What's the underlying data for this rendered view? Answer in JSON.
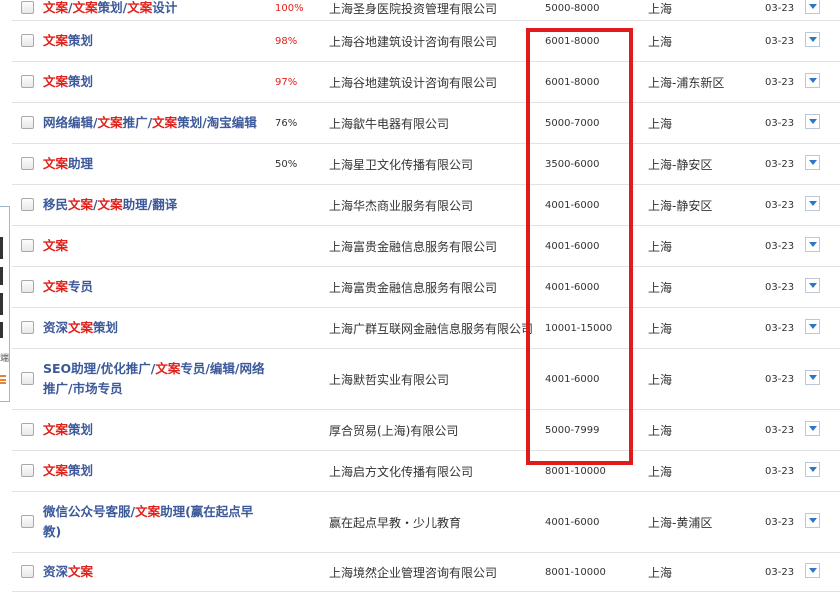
{
  "side_widget": {
    "text": "端"
  },
  "jobs": [
    {
      "title": [
        {
          "t": "文案",
          "hl": true
        },
        {
          "t": "/"
        },
        {
          "t": "文案",
          "hl": true
        },
        {
          "t": "策划/"
        },
        {
          "t": "文案",
          "hl": true
        },
        {
          "t": "设计"
        }
      ],
      "match": "100%",
      "match_red": true,
      "company": "上海圣身医院投资管理有限公司",
      "salary": "5000-8000",
      "location": "上海",
      "date": "03-23"
    },
    {
      "title": [
        {
          "t": "文案",
          "hl": true
        },
        {
          "t": "策划"
        }
      ],
      "match": "98%",
      "match_red": true,
      "company": "上海谷地建筑设计咨询有限公司",
      "salary": "6001-8000",
      "location": "上海",
      "date": "03-23"
    },
    {
      "title": [
        {
          "t": "文案",
          "hl": true
        },
        {
          "t": "策划"
        }
      ],
      "match": "97%",
      "match_red": true,
      "company": "上海谷地建筑设计咨询有限公司",
      "salary": "6001-8000",
      "location": "上海-浦东新区",
      "date": "03-23"
    },
    {
      "title": [
        {
          "t": "网络编辑/"
        },
        {
          "t": "文案",
          "hl": true
        },
        {
          "t": "推广/"
        },
        {
          "t": "文案",
          "hl": true
        },
        {
          "t": "策划/淘宝编辑"
        }
      ],
      "match": "76%",
      "match_red": false,
      "company": "上海歙牛电器有限公司",
      "salary": "5000-7000",
      "location": "上海",
      "date": "03-23"
    },
    {
      "title": [
        {
          "t": "文案",
          "hl": true
        },
        {
          "t": "助理"
        }
      ],
      "match": "50%",
      "match_red": false,
      "company": "上海星卫文化传播有限公司",
      "salary": "3500-6000",
      "location": "上海-静安区",
      "date": "03-23"
    },
    {
      "title": [
        {
          "t": "移民"
        },
        {
          "t": "文案",
          "hl": true
        },
        {
          "t": "/"
        },
        {
          "t": "文案",
          "hl": true
        },
        {
          "t": "助理/翻译"
        }
      ],
      "match": "",
      "match_red": false,
      "company": "上海华杰商业服务有限公司",
      "salary": "4001-6000",
      "location": "上海-静安区",
      "date": "03-23"
    },
    {
      "title": [
        {
          "t": "文案",
          "hl": true
        }
      ],
      "match": "",
      "match_red": false,
      "company": "上海富贵金融信息服务有限公司",
      "salary": "4001-6000",
      "location": "上海",
      "date": "03-23"
    },
    {
      "title": [
        {
          "t": "文案",
          "hl": true
        },
        {
          "t": "专员"
        }
      ],
      "match": "",
      "match_red": false,
      "company": "上海富贵金融信息服务有限公司",
      "salary": "4001-6000",
      "location": "上海",
      "date": "03-23"
    },
    {
      "title": [
        {
          "t": "资深"
        },
        {
          "t": "文案",
          "hl": true
        },
        {
          "t": "策划"
        }
      ],
      "match": "",
      "match_red": false,
      "company": "上海广群互联网金融信息服务有限公司",
      "salary": "10001-15000",
      "location": "上海",
      "date": "03-23"
    },
    {
      "title": [
        {
          "t": "SEO助理/优化推广/"
        },
        {
          "t": "文案",
          "hl": true
        },
        {
          "t": "专员/编辑/网络推广/市场专员"
        }
      ],
      "match": "",
      "match_red": false,
      "company": "上海默哲实业有限公司",
      "salary": "4001-6000",
      "location": "上海",
      "date": "03-23"
    },
    {
      "title": [
        {
          "t": "文案",
          "hl": true
        },
        {
          "t": "策划"
        }
      ],
      "match": "",
      "match_red": false,
      "company": "厚合贸易(上海)有限公司",
      "salary": "5000-7999",
      "location": "上海",
      "date": "03-23"
    },
    {
      "title": [
        {
          "t": "文案",
          "hl": true
        },
        {
          "t": "策划"
        }
      ],
      "match": "",
      "match_red": false,
      "company": "上海启方文化传播有限公司",
      "salary": "8001-10000",
      "location": "上海",
      "date": "03-23"
    },
    {
      "title": [
        {
          "t": "微信公众号客服/"
        },
        {
          "t": "文案",
          "hl": true
        },
        {
          "t": "助理(赢在起点早教)"
        }
      ],
      "match": "",
      "match_red": false,
      "company": "赢在起点早教・少儿教育",
      "salary": "4001-6000",
      "location": "上海-黄浦区",
      "date": "03-23"
    },
    {
      "title": [
        {
          "t": "资深"
        },
        {
          "t": "文案",
          "hl": true
        }
      ],
      "match": "",
      "match_red": false,
      "company": "上海境然企业管理咨询有限公司",
      "salary": "8001-10000",
      "location": "上海",
      "date": "03-23"
    }
  ],
  "colors": {
    "highlight": "#e0221c",
    "title": "#3c5a9a",
    "frame": "#e01b1b"
  }
}
